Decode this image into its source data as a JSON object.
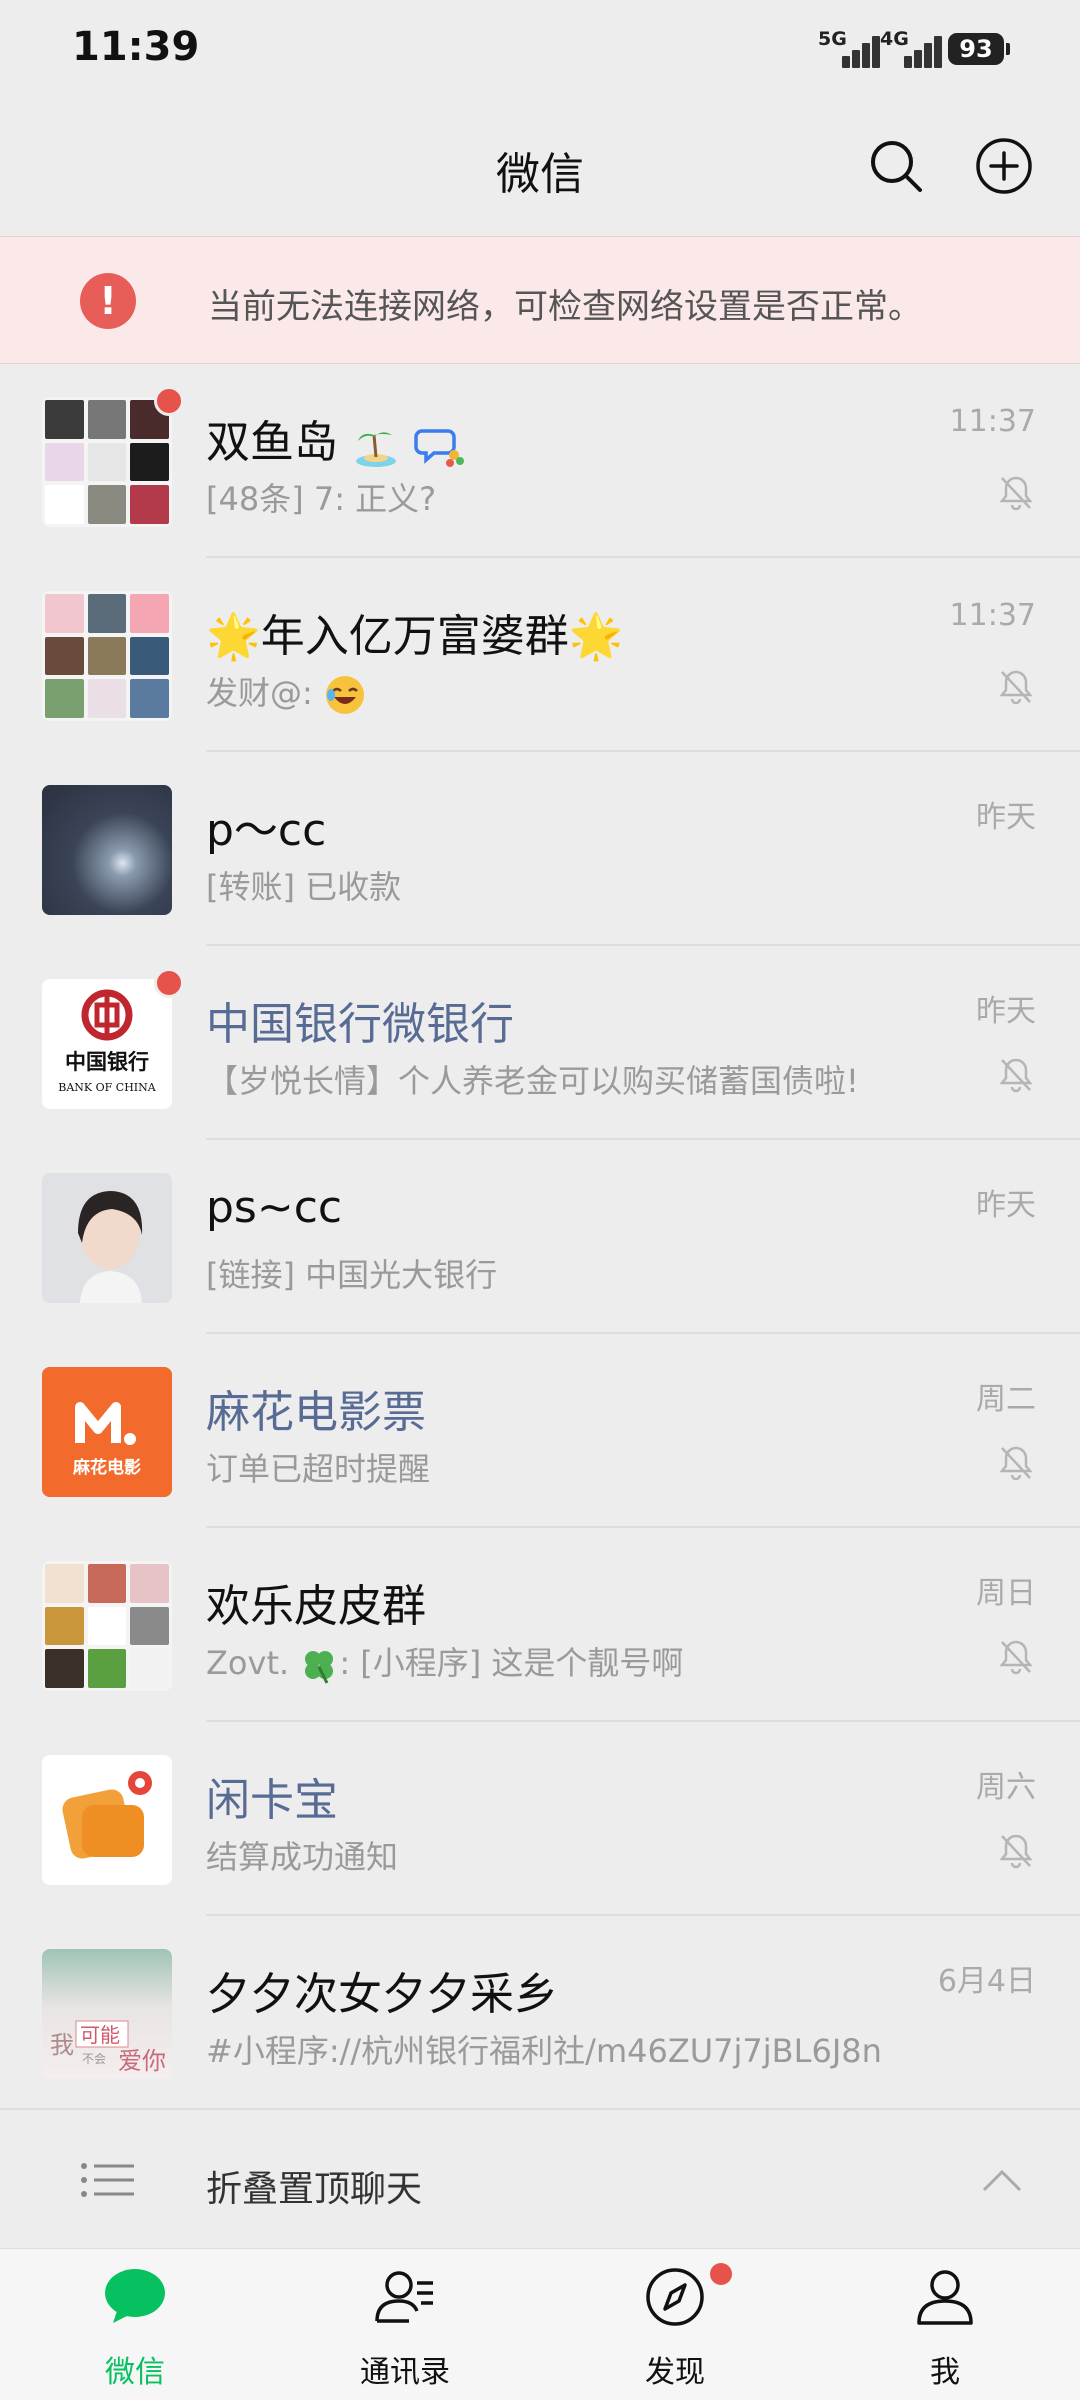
{
  "status_bar": {
    "time": "11:39",
    "signal1_label": "5G",
    "signal2_label": "4G",
    "battery": "93"
  },
  "header": {
    "title": "微信",
    "search_icon": "search-icon",
    "add_icon": "plus-circle-icon"
  },
  "warning": {
    "icon_text": "!",
    "text": "当前无法连接网络，可检查网络设置是否正常。"
  },
  "chats": [
    {
      "name": "双鱼岛",
      "preview": "[48条] 7: 正义?",
      "time": "11:37",
      "muted": true,
      "unread_dot": true
    },
    {
      "name_prefix": "🌟",
      "name": "年入亿万富婆群",
      "name_suffix": "🌟",
      "preview": "发财@: ",
      "time": "11:37",
      "muted": true
    },
    {
      "name": "p～cc",
      "preview": "[转账] 已收款",
      "time": "昨天",
      "muted": false
    },
    {
      "name": "中国银行微银行",
      "preview": "【岁悦长情】个人养老金可以购买储蓄国债啦!",
      "time": "昨天",
      "muted": true,
      "unread_dot": true,
      "official": true,
      "avatar_cn": "中国银行",
      "avatar_en": "BANK OF CHINA"
    },
    {
      "name": "ps~cc",
      "preview": "[链接] 中国光大银行",
      "time": "昨天",
      "muted": false
    },
    {
      "name": "麻花电影票",
      "preview": "订单已超时提醒",
      "time": "周二",
      "muted": true,
      "official": true,
      "avatar_text": "麻花电影"
    },
    {
      "name": "欢乐皮皮群",
      "preview_a": "Zovt. ",
      "preview_b": ": [小程序] 这是个靓号啊",
      "time": "周日",
      "muted": true
    },
    {
      "name": "闲卡宝",
      "preview": "结算成功通知",
      "time": "周六",
      "muted": true,
      "official": true
    },
    {
      "name": "夕夕次女夕夕采乡",
      "preview": "#小程序://杭州银行福利社/m46ZU7j7jBL6J8n",
      "time": "6月4日",
      "muted": false,
      "avatar_text_a": "我",
      "avatar_text_b": "可能",
      "avatar_text_c": "不会",
      "avatar_text_d": "爱你"
    }
  ],
  "fold": {
    "label": "折叠置顶聊天"
  },
  "bottom_nav": [
    {
      "label": "微信",
      "icon": "chat-bubble-icon",
      "active": true
    },
    {
      "label": "通讯录",
      "icon": "contacts-icon",
      "active": false
    },
    {
      "label": "发现",
      "icon": "compass-icon",
      "active": false,
      "dot": true
    },
    {
      "label": "我",
      "icon": "person-icon",
      "active": false
    }
  ],
  "colors": {
    "accent_green": "#07c160",
    "warning_bg": "#fbe9ea",
    "warning_icon": "#e75e58",
    "official_name": "#576b95",
    "unread_dot": "#e5534b"
  }
}
